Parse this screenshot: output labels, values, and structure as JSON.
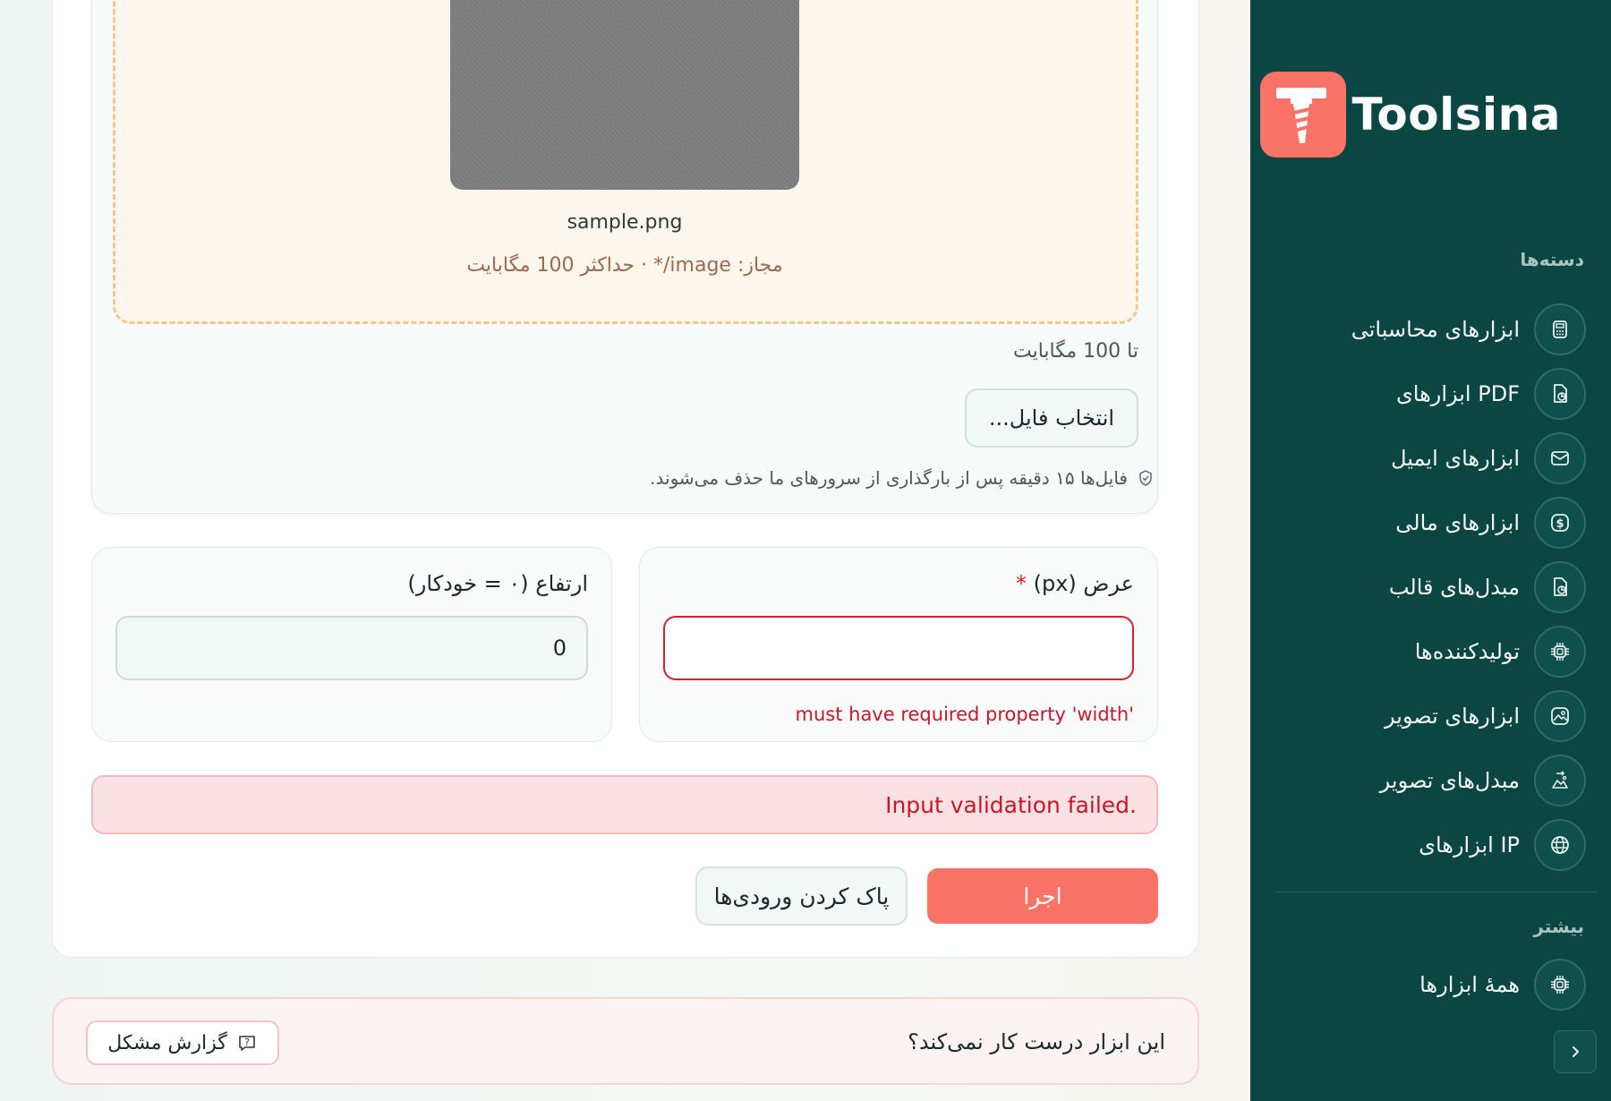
{
  "brand": {
    "name": "Toolsina",
    "accent": "#f97366",
    "sidebar_bg": "#0c4643"
  },
  "upload": {
    "filename": "sample.png",
    "allowed": "مجاز: image/* · حداکثر 100 مگابایت",
    "limit": "تا 100 مگابایت",
    "choose_label": "انتخاب فایل...",
    "notice": "فایل‌ها ۱۵ دقیقه پس از بارگذاری از سرورهای ما حذف می‌شوند."
  },
  "fields": {
    "width": {
      "label": "عرض (px)",
      "required_mark": "*",
      "value": "",
      "error": "must have required property 'width'"
    },
    "height": {
      "label": "ارتفاع (۰ = خودکار)",
      "value": "0"
    }
  },
  "alert": {
    "message": "Input validation failed."
  },
  "actions": {
    "run": "اجرا",
    "clear": "پاک کردن ورودی‌ها"
  },
  "report": {
    "question": "این ابزار درست کار نمی‌کند؟",
    "button": "گزارش مشکل"
  },
  "sidebar": {
    "categories_heading": "دسته‌ها",
    "items": [
      {
        "label": "ابزارهای محاسباتی",
        "icon": "calculator-icon"
      },
      {
        "label": "ابزارهای PDF",
        "icon": "file-chart-icon"
      },
      {
        "label": "ابزارهای ایمیل",
        "icon": "mail-icon"
      },
      {
        "label": "ابزارهای مالی",
        "icon": "dollar-icon"
      },
      {
        "label": "مبدل‌های قالب",
        "icon": "file-chart-icon"
      },
      {
        "label": "تولیدکننده‌ها",
        "icon": "cpu-icon"
      },
      {
        "label": "ابزارهای تصویر",
        "icon": "image-icon"
      },
      {
        "label": "مبدل‌های تصویر",
        "icon": "image-convert-icon"
      },
      {
        "label": "ابزارهای IP",
        "icon": "globe-icon"
      }
    ],
    "more_heading": "بیشتر",
    "all_tools": {
      "label": "همهٔ ابزارها",
      "icon": "cpu-icon"
    }
  }
}
